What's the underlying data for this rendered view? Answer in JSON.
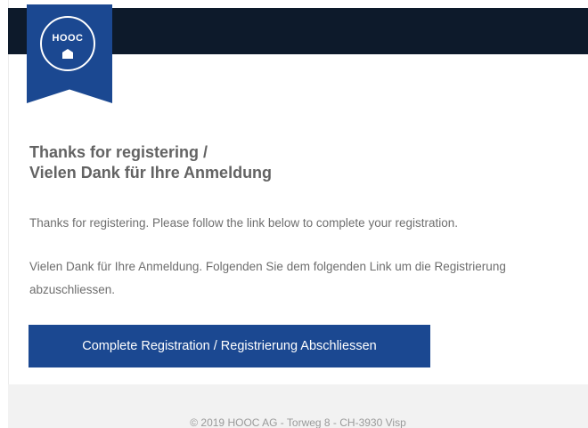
{
  "brand": {
    "logo_text": "HOOC",
    "header_color": "#0d1a2b",
    "accent_color": "#1b4891"
  },
  "email": {
    "title_line1": "Thanks for registering /",
    "title_line2": "Vielen Dank für Ihre Anmeldung",
    "body_en": "Thanks for registering. Please follow the link below to complete your registration.",
    "body_de": "Vielen Dank für Ihre Anmeldung. Folgenden Sie dem folgenden Link um die Registrierung abzuschliessen.",
    "cta_label": "Complete Registration / Registrierung Abschliessen"
  },
  "footer": {
    "text": "© 2019 HOOC AG - Torweg 8 - CH-3930 Visp"
  }
}
